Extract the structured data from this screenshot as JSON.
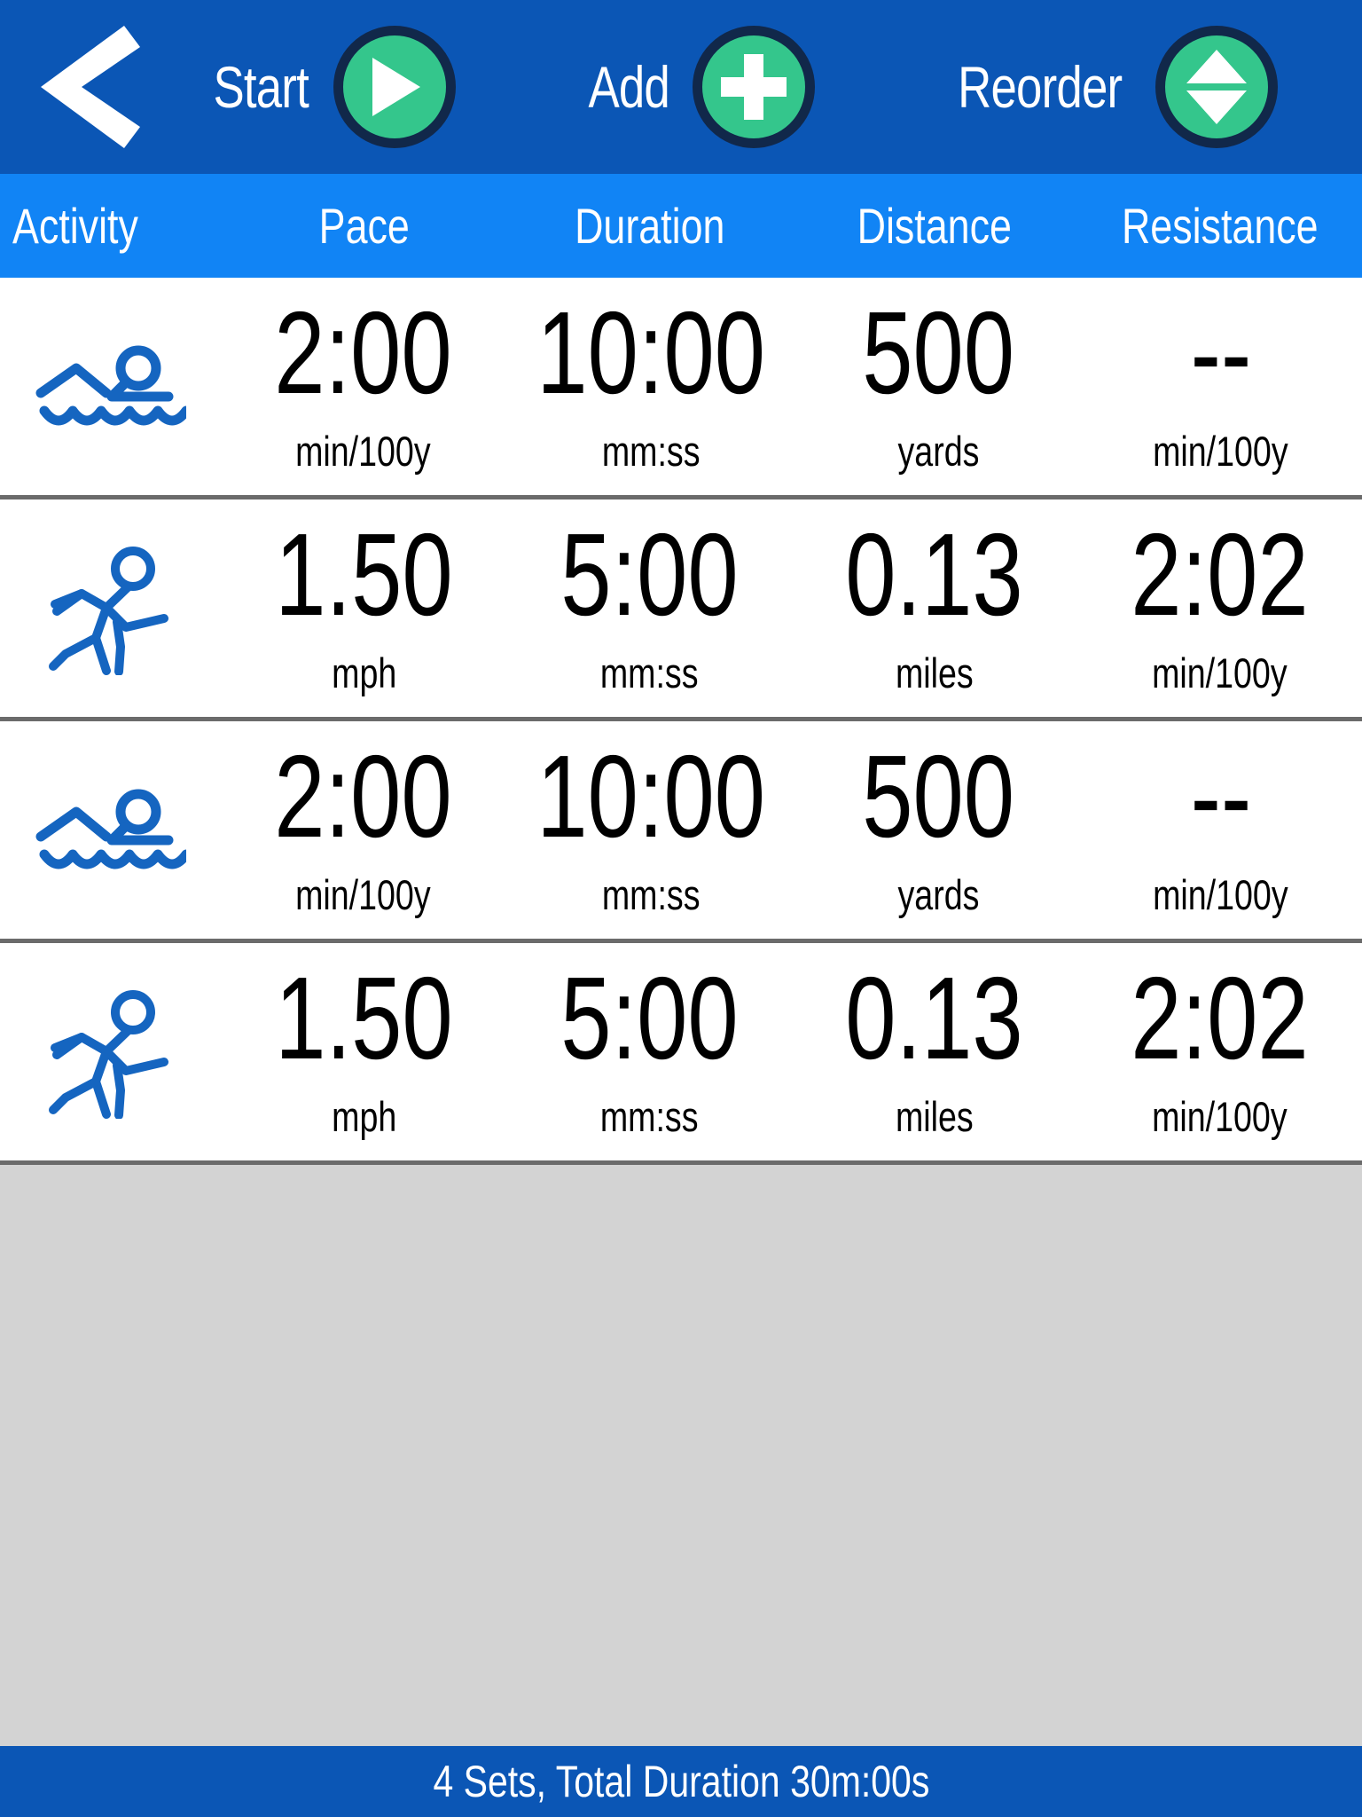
{
  "toolbar": {
    "back_icon": "chevron-left-icon",
    "actions": [
      {
        "label": "Start",
        "icon": "play-icon"
      },
      {
        "label": "Add",
        "icon": "plus-icon"
      },
      {
        "label": "Reorder",
        "icon": "up-down-arrows-icon"
      }
    ]
  },
  "table": {
    "columns": [
      "Activity",
      "Pace",
      "Duration",
      "Distance",
      "Resistance"
    ],
    "rows": [
      {
        "activity_icon": "swimmer-icon",
        "pace": {
          "value": "2:00",
          "unit": "min/100y"
        },
        "duration": {
          "value": "10:00",
          "unit": "mm:ss"
        },
        "distance": {
          "value": "500",
          "unit": "yards"
        },
        "resistance": {
          "value": "--",
          "unit": "min/100y"
        }
      },
      {
        "activity_icon": "runner-icon",
        "pace": {
          "value": "1.50",
          "unit": "mph"
        },
        "duration": {
          "value": "5:00",
          "unit": "mm:ss"
        },
        "distance": {
          "value": "0.13",
          "unit": "miles"
        },
        "resistance": {
          "value": "2:02",
          "unit": "min/100y"
        }
      },
      {
        "activity_icon": "swimmer-icon",
        "pace": {
          "value": "2:00",
          "unit": "min/100y"
        },
        "duration": {
          "value": "10:00",
          "unit": "mm:ss"
        },
        "distance": {
          "value": "500",
          "unit": "yards"
        },
        "resistance": {
          "value": "--",
          "unit": "min/100y"
        }
      },
      {
        "activity_icon": "runner-icon",
        "pace": {
          "value": "1.50",
          "unit": "mph"
        },
        "duration": {
          "value": "5:00",
          "unit": "mm:ss"
        },
        "distance": {
          "value": "0.13",
          "unit": "miles"
        },
        "resistance": {
          "value": "2:02",
          "unit": "min/100y"
        }
      }
    ]
  },
  "footer": {
    "summary": "4 Sets, Total Duration 30m:00s"
  },
  "colors": {
    "toolbar_blue": "#0b56b5",
    "header_blue": "#1184f5",
    "accent_green": "#34c68c",
    "ring_navy": "#11284a",
    "icon_blue": "#1565c0",
    "empty_gray": "#d3d3d3",
    "divider_gray": "#6b6b6b"
  }
}
